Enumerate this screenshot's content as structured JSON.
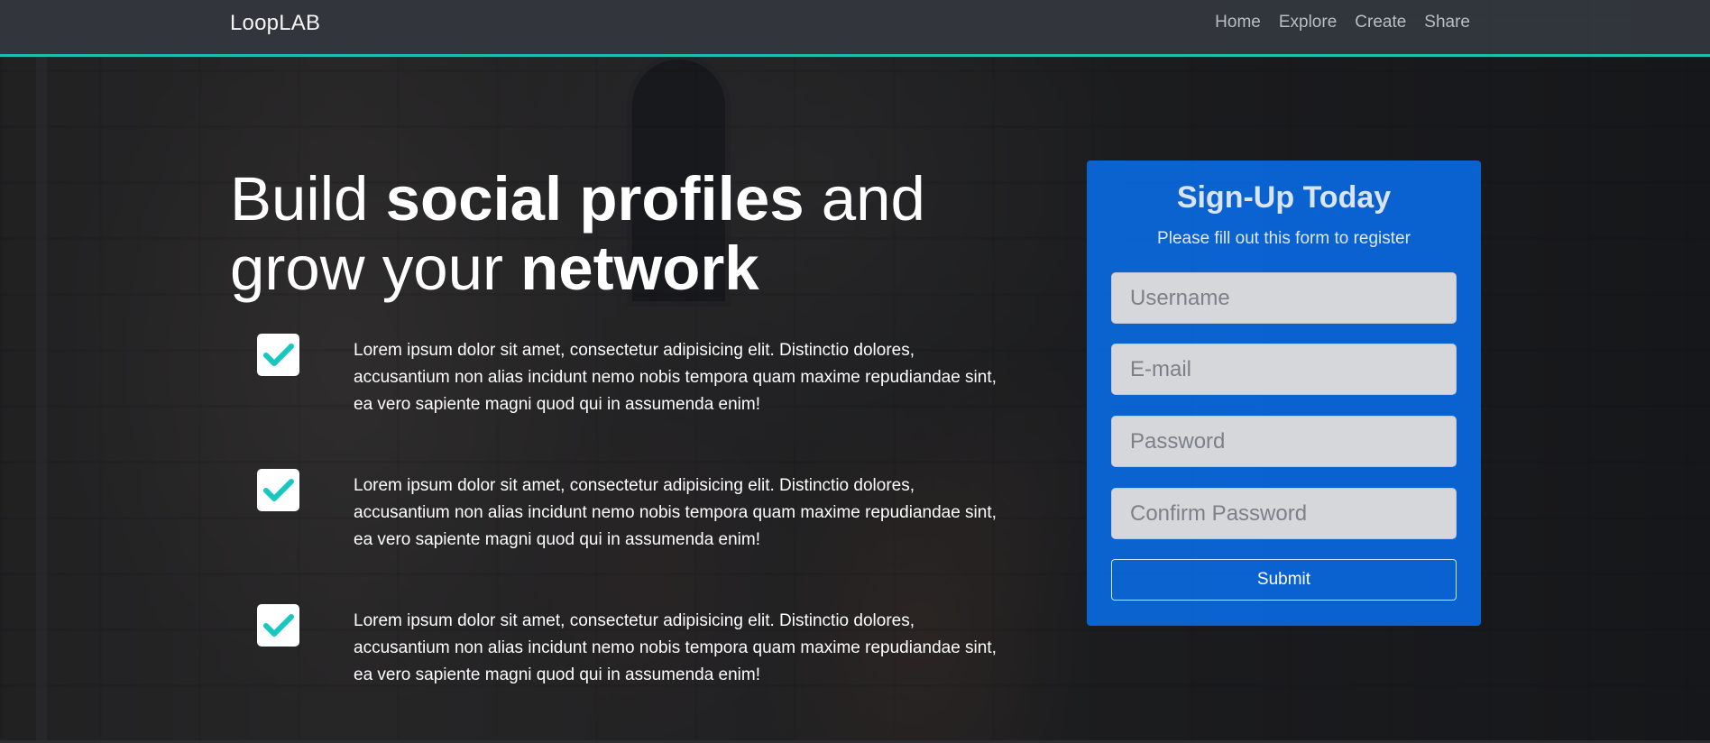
{
  "navbar": {
    "brand": "LoopLAB",
    "links": [
      "Home",
      "Explore",
      "Create",
      "Share"
    ],
    "accent_color": "#17c0b0"
  },
  "hero": {
    "title_part1": "Build ",
    "title_bold1": "social profiles",
    "title_part2": " and grow your ",
    "title_bold2": "network"
  },
  "features": [
    {
      "icon": "check-icon",
      "text": "Lorem ipsum dolor sit amet, consectetur adipisicing elit. Distinctio dolores, accusantium non alias incidunt nemo nobis tempora quam maxime repudiandae sint, ea vero sapiente magni quod qui in assumenda enim!"
    },
    {
      "icon": "check-icon",
      "text": "Lorem ipsum dolor sit amet, consectetur adipisicing elit. Distinctio dolores, accusantium non alias incidunt nemo nobis tempora quam maxime repudiandae sint, ea vero sapiente magni quod qui in assumenda enim!"
    },
    {
      "icon": "check-icon",
      "text": "Lorem ipsum dolor sit amet, consectetur adipisicing elit. Distinctio dolores, accusantium non alias incidunt nemo nobis tempora quam maxime repudiandae sint, ea vero sapiente magni quod qui in assumenda enim!"
    }
  ],
  "signup": {
    "title": "Sign-Up Today",
    "subtitle": "Please fill out this form to register",
    "fields": {
      "username_placeholder": "Username",
      "email_placeholder": "E-mail",
      "password_placeholder": "Password",
      "confirm_placeholder": "Confirm Password"
    },
    "submit_label": "Submit",
    "card_color": "#0a68de"
  },
  "colors": {
    "check": "#17c7c0"
  }
}
